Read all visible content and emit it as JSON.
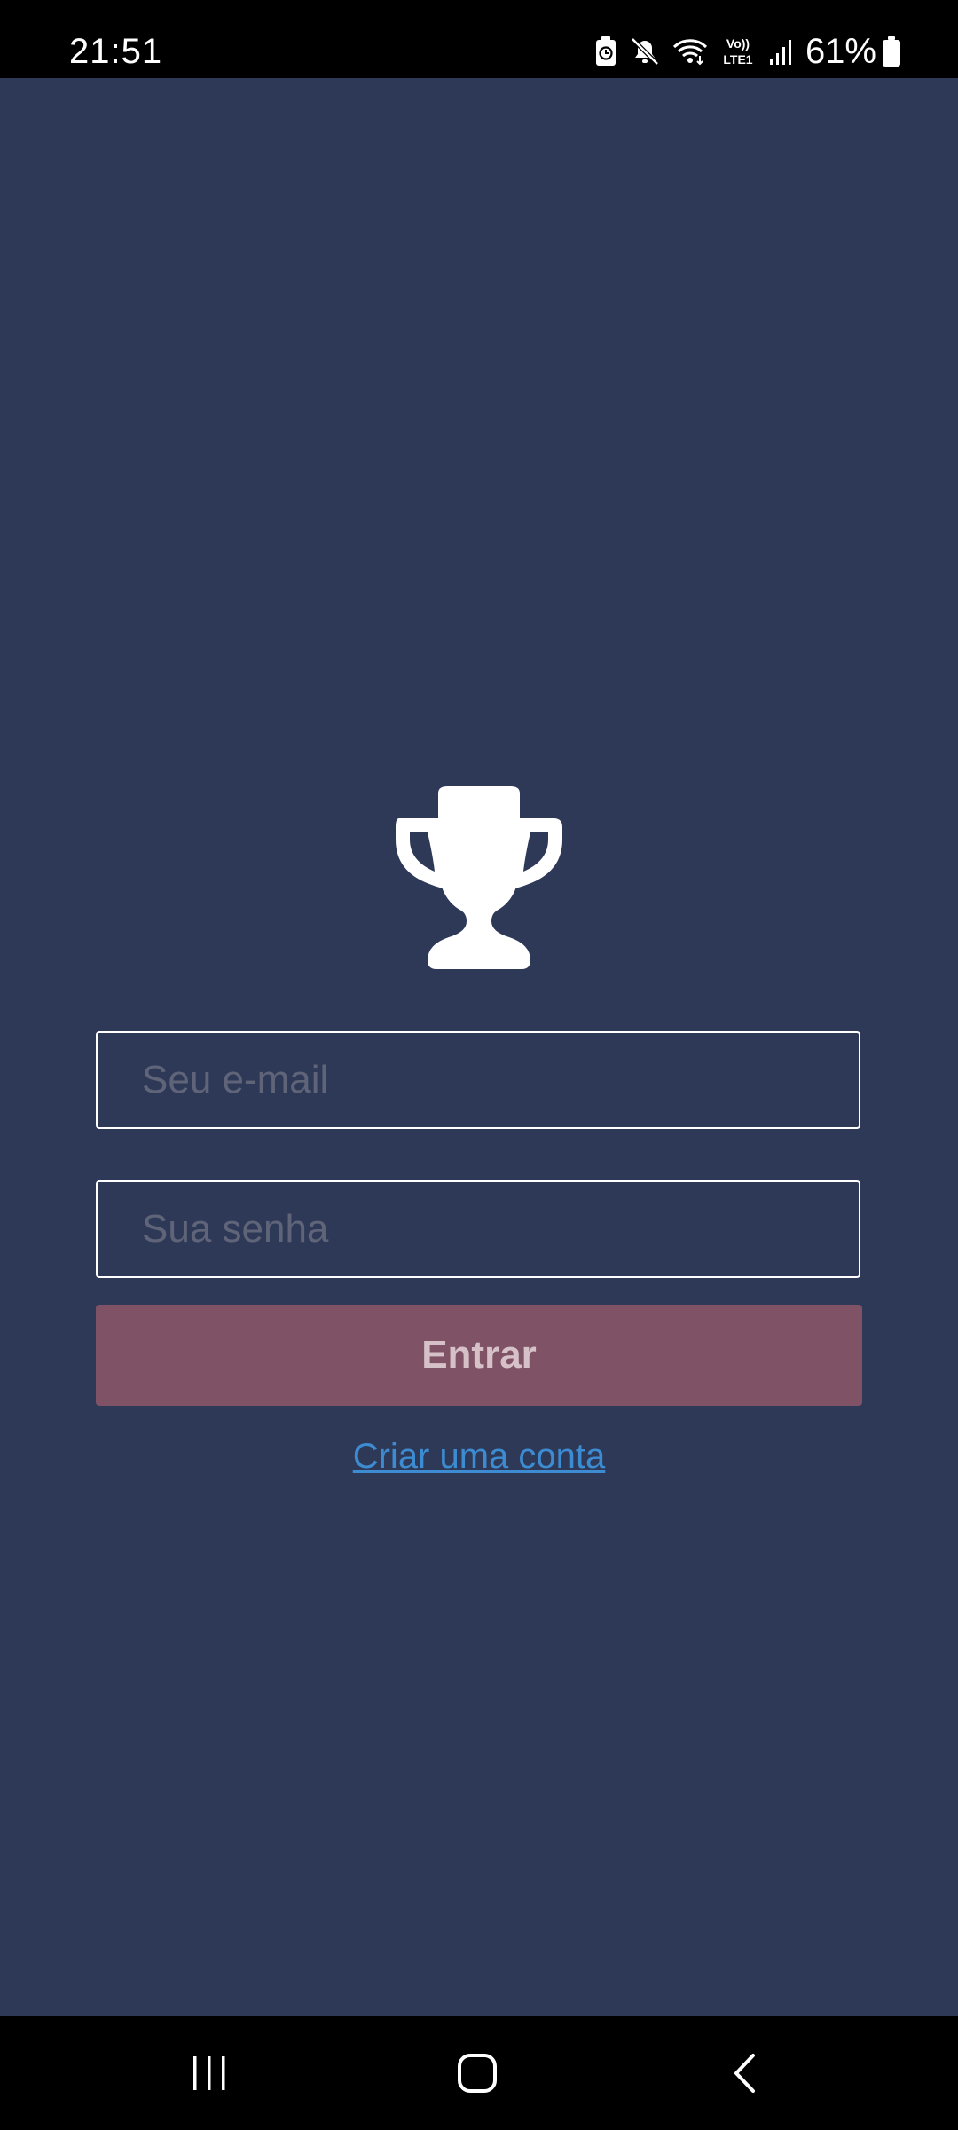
{
  "status_bar": {
    "time": "21:51",
    "battery_percent": "61%",
    "network_label_top": "Vo))",
    "network_label_bottom": "LTE1",
    "icons": [
      "battery-saver-icon",
      "mute-icon",
      "wifi-icon",
      "volte-icon",
      "signal-icon",
      "battery-icon"
    ]
  },
  "login": {
    "logo_icon": "trophy-icon",
    "email_placeholder": "Seu e-mail",
    "email_value": "",
    "password_placeholder": "Sua senha",
    "password_value": "",
    "submit_label": "Entrar",
    "create_account_label": "Criar uma conta"
  },
  "nav_bar": {
    "icons": [
      "recents-icon",
      "home-icon",
      "back-icon"
    ]
  },
  "colors": {
    "background": "#2e3958",
    "button": "#7f5365",
    "button_text": "#d7c1c8",
    "link": "#3d8bd0",
    "placeholder": "#5f6478"
  }
}
